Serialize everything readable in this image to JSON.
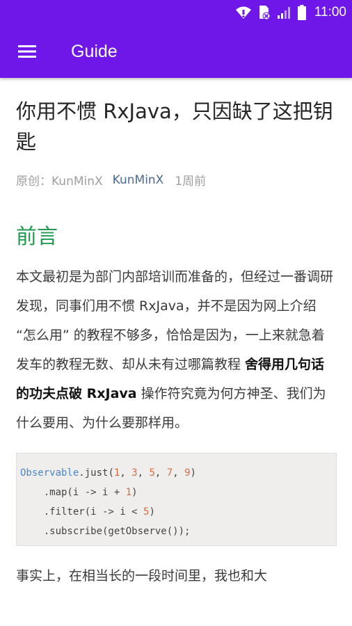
{
  "status_bar": {
    "time": "11:00",
    "icons": [
      "wifi-icon",
      "sim-no-signal-icon",
      "cellular-signal-icon",
      "battery-icon"
    ]
  },
  "toolbar": {
    "menu_icon": "hamburger-menu-icon",
    "title": "Guide"
  },
  "article": {
    "title": "你用不惯 RxJava，只因缺了这把钥匙",
    "meta": {
      "source_label": "原创：KunMinX",
      "author": "KunMinX",
      "time": "1周前"
    },
    "section_heading": "前言",
    "paragraph1": {
      "text_before": "本文最初是为部门内部培训而准备的，但经过一番调研发现，同事们用不惯 RxJava，并不是因为网上介绍 “怎么用” 的教程不够多，恰恰是因为，一上来就急着发车的教程无数、却从未有过哪篇教程 ",
      "emphasis_1": "舍得用几句话的功夫点破 ",
      "emphasis_2": "RxJava",
      "text_after": " 操作符究竟为何方神圣、我们为什么要用、为什么要那样用。"
    },
    "code": {
      "line1_class": "Observable",
      "line1_call": ".just(",
      "line1_nums": [
        "1",
        "3",
        "5",
        "7",
        "9"
      ],
      "line1_sep": ", ",
      "line1_end": ")",
      "line2_pre": "    .map(i -> i + ",
      "line2_num": "1",
      "line2_end": ")",
      "line3_pre": "    .filter(i -> i < ",
      "line3_num": "5",
      "line3_end": ")",
      "line4": "    .subscribe(getObserve());"
    },
    "paragraph2": "事实上，在相当长的一段时间里，我也和大"
  },
  "colors": {
    "app_bar": "#6f16e8",
    "heading": "#1f9a4f",
    "author_link": "#4a6a8f",
    "code_class": "#4a86c8",
    "code_number": "#d46d3e"
  }
}
